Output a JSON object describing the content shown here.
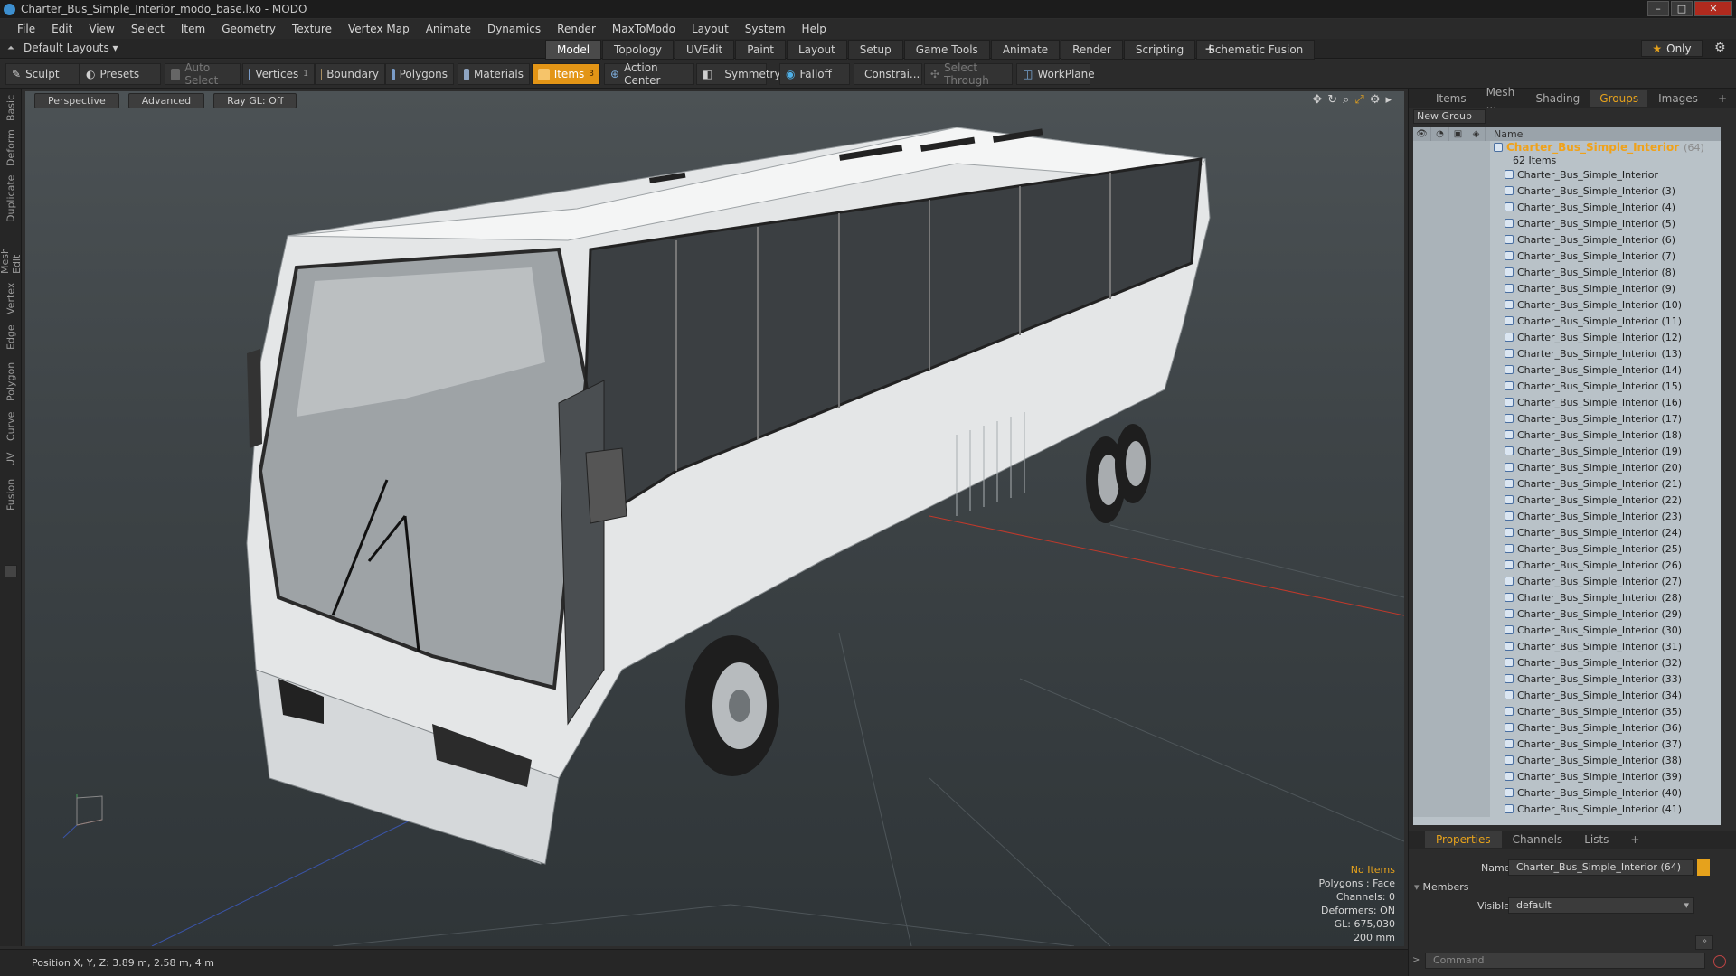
{
  "window": {
    "title": "Charter_Bus_Simple_Interior_modo_base.lxo - MODO"
  },
  "menu": [
    "File",
    "Edit",
    "View",
    "Select",
    "Item",
    "Geometry",
    "Texture",
    "Vertex Map",
    "Animate",
    "Dynamics",
    "Render",
    "MaxToModo",
    "Layout",
    "System",
    "Help"
  ],
  "layout": {
    "preset": "Default Layouts ▾",
    "tabs": [
      "Model",
      "Topology",
      "UVEdit",
      "Paint",
      "Layout",
      "Setup",
      "Game Tools",
      "Animate",
      "Render",
      "Scripting",
      "Schematic Fusion"
    ],
    "active_tab": "Model",
    "only_label": "Only"
  },
  "toolbar": {
    "sculpt": "Sculpt",
    "presets": "Presets",
    "auto_select": "Auto Select",
    "vertices": "Vertices",
    "vertices_count": "1",
    "boundary": "Boundary",
    "polygons": "Polygons",
    "materials": "Materials",
    "items": "Items",
    "items_count": "3",
    "action_center": "Action Center",
    "symmetry": "Symmetry",
    "falloff": "Falloff",
    "constraints": "Constrai...",
    "select_through": "Select Through",
    "workplane": "WorkPlane"
  },
  "left_tabs": [
    "Basic",
    "Deform",
    "Duplicate",
    "Mesh Edit",
    "Vertex",
    "Edge",
    "Polygon",
    "Curve",
    "UV",
    "Fusion"
  ],
  "viewport": {
    "view": "Perspective",
    "shading": "Advanced",
    "raygl": "Ray GL: Off",
    "info": {
      "no_items": "No Items",
      "polygons": "Polygons : Face",
      "channels": "Channels: 0",
      "deformers": "Deformers: ON",
      "gl": "GL: 675,030",
      "scale": "200 mm"
    }
  },
  "status": {
    "position": "Position X, Y, Z:  3.89 m, 2.58 m, 4 m"
  },
  "panel": {
    "tabs": [
      "Items",
      "Mesh ...",
      "Shading",
      "Groups",
      "Images"
    ],
    "active_tab": "Groups",
    "new_group": "New Group",
    "name_col": "Name",
    "group": {
      "name": "Charter_Bus_Simple_Interior",
      "count": "(64)",
      "items": "62 Items"
    },
    "rows": [
      "Charter_Bus_Simple_Interior",
      "Charter_Bus_Simple_Interior (3)",
      "Charter_Bus_Simple_Interior (4)",
      "Charter_Bus_Simple_Interior (5)",
      "Charter_Bus_Simple_Interior (6)",
      "Charter_Bus_Simple_Interior (7)",
      "Charter_Bus_Simple_Interior (8)",
      "Charter_Bus_Simple_Interior (9)",
      "Charter_Bus_Simple_Interior (10)",
      "Charter_Bus_Simple_Interior (11)",
      "Charter_Bus_Simple_Interior (12)",
      "Charter_Bus_Simple_Interior (13)",
      "Charter_Bus_Simple_Interior (14)",
      "Charter_Bus_Simple_Interior (15)",
      "Charter_Bus_Simple_Interior (16)",
      "Charter_Bus_Simple_Interior (17)",
      "Charter_Bus_Simple_Interior (18)",
      "Charter_Bus_Simple_Interior (19)",
      "Charter_Bus_Simple_Interior (20)",
      "Charter_Bus_Simple_Interior (21)",
      "Charter_Bus_Simple_Interior (22)",
      "Charter_Bus_Simple_Interior (23)",
      "Charter_Bus_Simple_Interior (24)",
      "Charter_Bus_Simple_Interior (25)",
      "Charter_Bus_Simple_Interior (26)",
      "Charter_Bus_Simple_Interior (27)",
      "Charter_Bus_Simple_Interior (28)",
      "Charter_Bus_Simple_Interior (29)",
      "Charter_Bus_Simple_Interior (30)",
      "Charter_Bus_Simple_Interior (31)",
      "Charter_Bus_Simple_Interior (32)",
      "Charter_Bus_Simple_Interior (33)",
      "Charter_Bus_Simple_Interior (34)",
      "Charter_Bus_Simple_Interior (35)",
      "Charter_Bus_Simple_Interior (36)",
      "Charter_Bus_Simple_Interior (37)",
      "Charter_Bus_Simple_Interior (38)",
      "Charter_Bus_Simple_Interior (39)",
      "Charter_Bus_Simple_Interior (40)",
      "Charter_Bus_Simple_Interior (41)"
    ]
  },
  "properties": {
    "tabs": [
      "Properties",
      "Channels",
      "Lists"
    ],
    "active_tab": "Properties",
    "name_label": "Name",
    "name_value": "Charter_Bus_Simple_Interior (64)",
    "members": "Members",
    "visible_label": "Visible",
    "visible_value": "default",
    "command_placeholder": "Command"
  },
  "colors": {
    "accent": "#e39516",
    "group_text": "#f0a21a"
  }
}
